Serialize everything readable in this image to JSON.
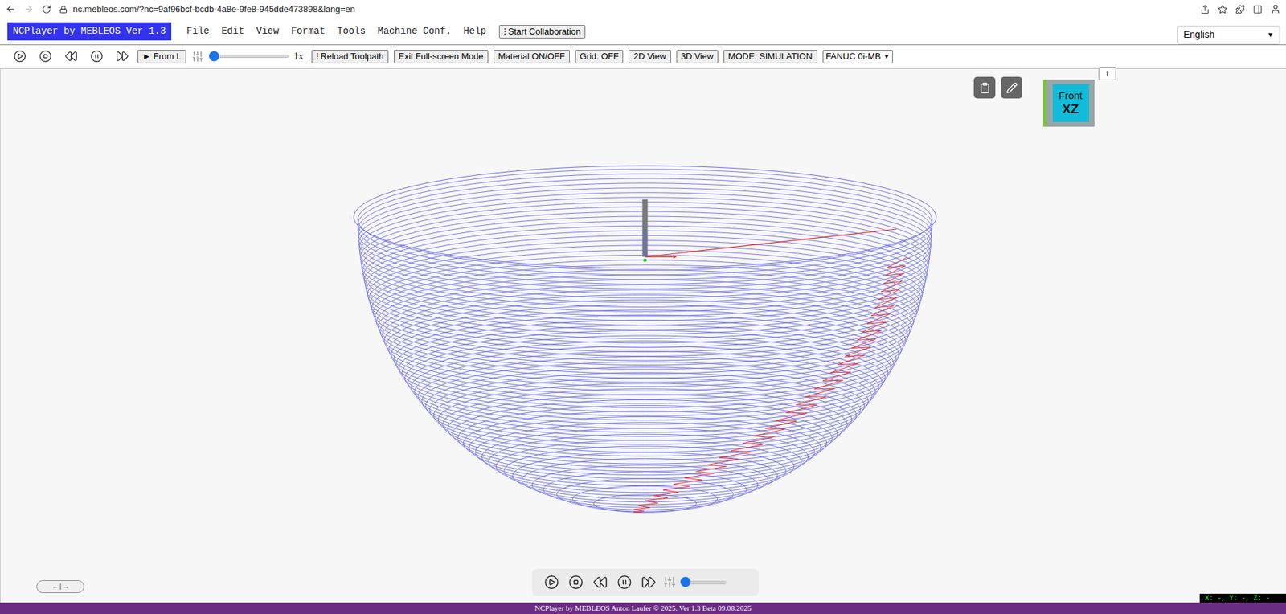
{
  "browser": {
    "url": "nc.mebleos.com/?nc=9af96bcf-bcdb-4a8e-9fe8-945dde473898&lang=en"
  },
  "app": {
    "title": "NCPlayer by MEBLEOS Ver 1.3",
    "menu": [
      "File",
      "Edit",
      "View",
      "Format",
      "Tools",
      "Machine Conf.",
      "Help"
    ],
    "collaboration_button": "⁝ Start Collaboration",
    "language": "English"
  },
  "toolbar": {
    "from_button": "► From L",
    "speed_slider": {
      "level": 0
    },
    "speed": "1x",
    "buttons": [
      "⁝ Reload Toolpath",
      "Exit Full-screen Mode",
      "Material ON/OFF",
      "Grid: OFF",
      "2D View",
      "3D View",
      "MODE: SIMULATION"
    ],
    "machine": "FANUC 0i-MB"
  },
  "viewport": {
    "view_cube": {
      "face": "Front",
      "plane": "XZ"
    },
    "info_button": "i",
    "nav_pill": "← | →",
    "coordinates": "X: -, Y: -, Z: -",
    "playback_slider": {
      "level": 0
    }
  },
  "footer": "NCPlayer by MEBLEOS Anton Laufer © 2025. Ver 1.3 Beta 09.08.2025"
}
